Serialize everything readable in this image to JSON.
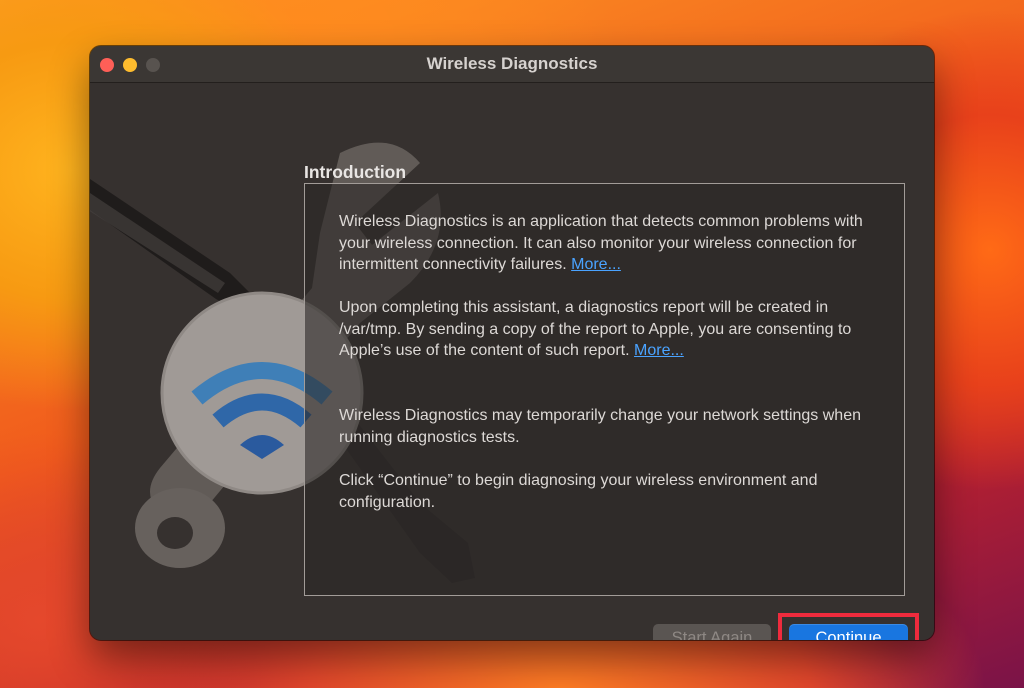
{
  "window": {
    "title": "Wireless Diagnostics"
  },
  "content": {
    "heading": "Introduction",
    "paragraphs": [
      {
        "text": "Wireless Diagnostics is an application that detects common problems with your wireless connection. It can also monitor your wireless connection for intermittent connectivity failures.",
        "link": "More..."
      },
      {
        "text": "Upon completing this assistant, a diagnostics report will be created in /var/tmp. By sending a copy of the report to Apple, you are consenting to Apple’s use of the content of such report.",
        "link": "More..."
      },
      {
        "text": "Wireless Diagnostics may temporarily change your network settings when running diagnostics tests."
      },
      {
        "text": "Click “Continue” to begin diagnosing your wireless environment and configuration."
      }
    ]
  },
  "buttons": {
    "start_again": "Start Again",
    "continue": "Continue"
  },
  "colors": {
    "accent": "#1976e0",
    "link": "#4aa3ff",
    "highlight": "#ef2b3d",
    "close": "#fe5f57",
    "minimize": "#febc2e"
  }
}
